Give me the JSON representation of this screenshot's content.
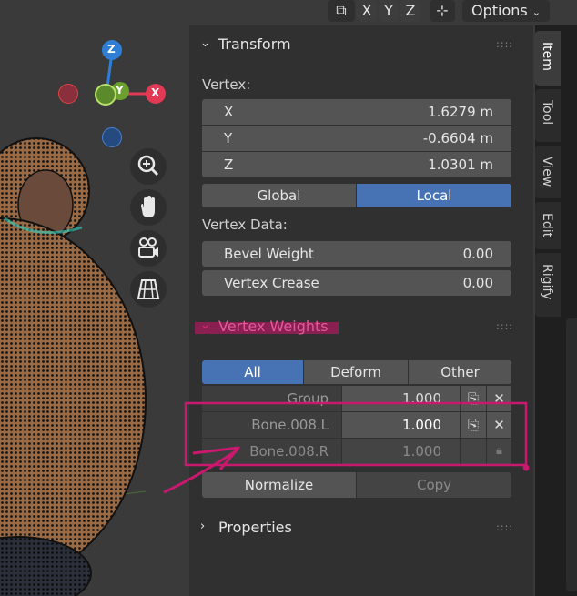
{
  "header": {
    "axis_x": "X",
    "axis_y": "Y",
    "axis_z": "Z",
    "options_label": "Options"
  },
  "gizmo": {
    "z_label": "Z",
    "y_label": "Y",
    "x_label": "X"
  },
  "transform": {
    "title": "Transform",
    "vertex_label": "Vertex:",
    "x_label": "X",
    "x_value": "1.6279 m",
    "y_label": "Y",
    "y_value": "-0.6604 m",
    "z_label": "Z",
    "z_value": "1.0301 m",
    "global_label": "Global",
    "local_label": "Local",
    "vertex_data_label": "Vertex Data:",
    "bevel_weight_label": "Bevel Weight",
    "bevel_weight_value": "0.00",
    "vertex_crease_label": "Vertex Crease",
    "vertex_crease_value": "0.00"
  },
  "vertex_weights": {
    "title": "Vertex Weights",
    "tab_all": "All",
    "tab_deform": "Deform",
    "tab_other": "Other",
    "rows": [
      {
        "name": "Group",
        "value": "1.000"
      },
      {
        "name": "Bone.008.L",
        "value": "1.000"
      },
      {
        "name": "Bone.008.R",
        "value": "1.000"
      }
    ],
    "normalize_label": "Normalize",
    "copy_label": "Copy"
  },
  "properties": {
    "title": "Properties"
  },
  "sidebar_tabs": {
    "item": "Item",
    "tool": "Tool",
    "view": "View",
    "edit": "Edit",
    "rigify": "Rigify"
  },
  "colors": {
    "accent_blue": "#4772b3",
    "annotation_pink": "#c8196e",
    "axis_x_red": "#e23a55",
    "axis_y_green": "#6aa02b",
    "axis_z_blue": "#2f7fd6"
  }
}
